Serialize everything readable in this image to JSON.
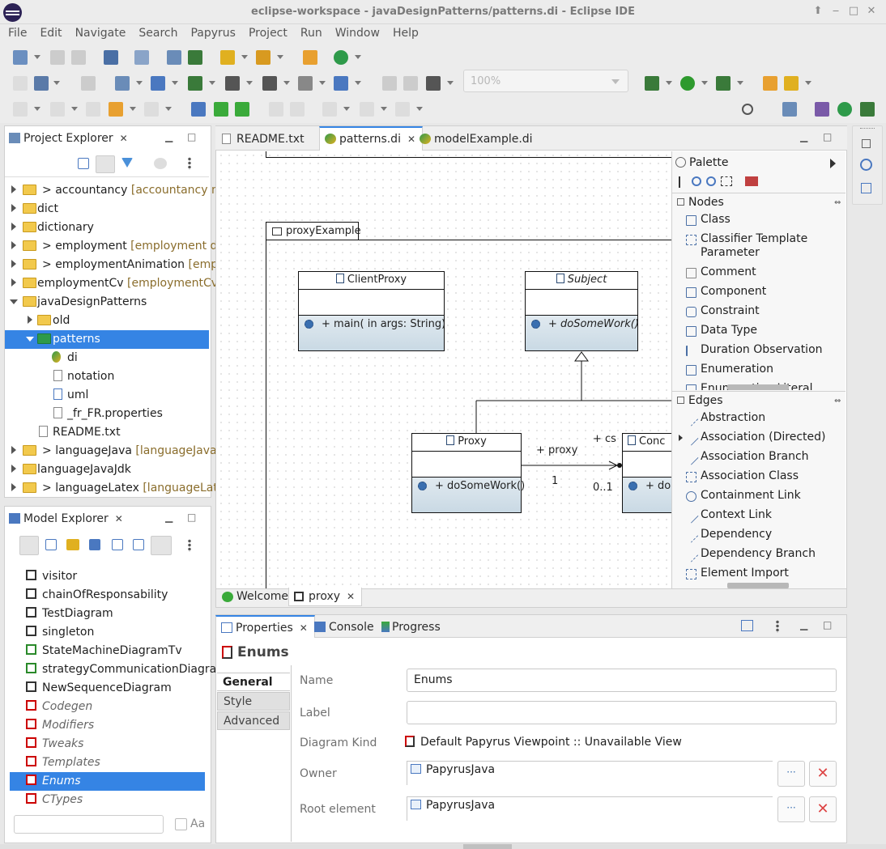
{
  "window": {
    "title": "eclipse-workspace - javaDesignPatterns/patterns.di - Eclipse IDE"
  },
  "menu": [
    "File",
    "Edit",
    "Navigate",
    "Search",
    "Papyrus",
    "Project",
    "Run",
    "Window",
    "Help"
  ],
  "toolbar": {
    "zoom_value": "100%"
  },
  "project_explorer": {
    "title": "Project Explorer",
    "items": [
      {
        "prefix": "> ",
        "name": "accountancy",
        "detail": "[accountancy ma"
      },
      {
        "prefix": "",
        "name": "dict",
        "detail": ""
      },
      {
        "prefix": "",
        "name": "dictionary",
        "detail": ""
      },
      {
        "prefix": "> ",
        "name": "employment",
        "detail": "[employment de"
      },
      {
        "prefix": "> ",
        "name": "employmentAnimation",
        "detail": "[emplo"
      },
      {
        "prefix": "",
        "name": "employmentCv",
        "detail": "[employmentCv"
      },
      {
        "prefix": "",
        "name": "javaDesignPatterns",
        "detail": ""
      },
      {
        "prefix": "",
        "name": "old",
        "detail": ""
      },
      {
        "prefix": "",
        "name": "patterns",
        "detail": ""
      },
      {
        "prefix": "",
        "name": "di",
        "detail": ""
      },
      {
        "prefix": "",
        "name": "notation",
        "detail": ""
      },
      {
        "prefix": "",
        "name": "uml",
        "detail": ""
      },
      {
        "prefix": "",
        "name": "_fr_FR.properties",
        "detail": ""
      },
      {
        "prefix": "",
        "name": "README.txt",
        "detail": ""
      },
      {
        "prefix": "> ",
        "name": "languageJava",
        "detail": "[languageJava m"
      },
      {
        "prefix": "",
        "name": "languageJavaJdk",
        "detail": ""
      },
      {
        "prefix": "> ",
        "name": "languageLatex",
        "detail": "[languageLatex"
      }
    ]
  },
  "model_explorer": {
    "title": "Model Explorer",
    "items": [
      "visitor",
      "chainOfResponsability",
      "TestDiagram",
      "singleton",
      "StateMachineDiagramTv",
      "strategyCommunicationDiagra",
      "NewSequenceDiagram",
      "Codegen",
      "Modifiers",
      "Tweaks",
      "Templates",
      "Enums",
      "CTypes"
    ],
    "filter_placeholder": "",
    "case_label": "Aa"
  },
  "editor": {
    "tabs": [
      "README.txt",
      "patterns.di",
      "modelExample.di"
    ],
    "bottom_tabs": [
      "Welcome",
      "proxy"
    ],
    "package_name": "proxyExample",
    "classes": {
      "client": {
        "name": "ClientProxy",
        "op": "+ main(  in args: String)"
      },
      "subject": {
        "name": "Subject",
        "op": "+ doSomeWork()"
      },
      "proxy": {
        "name": "Proxy",
        "op": "+ doSomeWork()"
      },
      "concrete": {
        "name": "Conc",
        "op": "+ do"
      }
    },
    "assoc": {
      "role1": "+ proxy",
      "mult1": "1",
      "role2": "+ cs",
      "mult2": "0..1"
    }
  },
  "palette": {
    "title": "Palette",
    "nodes_header": "Nodes",
    "nodes": [
      "Class",
      "Classifier Template",
      "Parameter",
      "Comment",
      "Component",
      "Constraint",
      "Data Type",
      "Duration Observation",
      "Enumeration",
      "Enumeration Literal"
    ],
    "edges_header": "Edges",
    "edges": [
      "Abstraction",
      "Association (Directed)",
      "Association Branch",
      "Association Class",
      "Containment Link",
      "Context Link",
      "Dependency",
      "Dependency Branch",
      "Element Import"
    ]
  },
  "properties": {
    "tabs": [
      "Properties",
      "Console",
      "Progress"
    ],
    "title": "Enums",
    "side_tabs": [
      "General",
      "Style",
      "Advanced"
    ],
    "name_label": "Name",
    "name_value": "Enums",
    "label_label": "Label",
    "label_value": "",
    "kind_label": "Diagram Kind",
    "kind_value": "Default Papyrus Viewpoint :: Unavailable View",
    "owner_label": "Owner",
    "owner_value": "PapyrusJava",
    "root_label": "Root element",
    "root_value": "PapyrusJava",
    "dots": "···"
  }
}
